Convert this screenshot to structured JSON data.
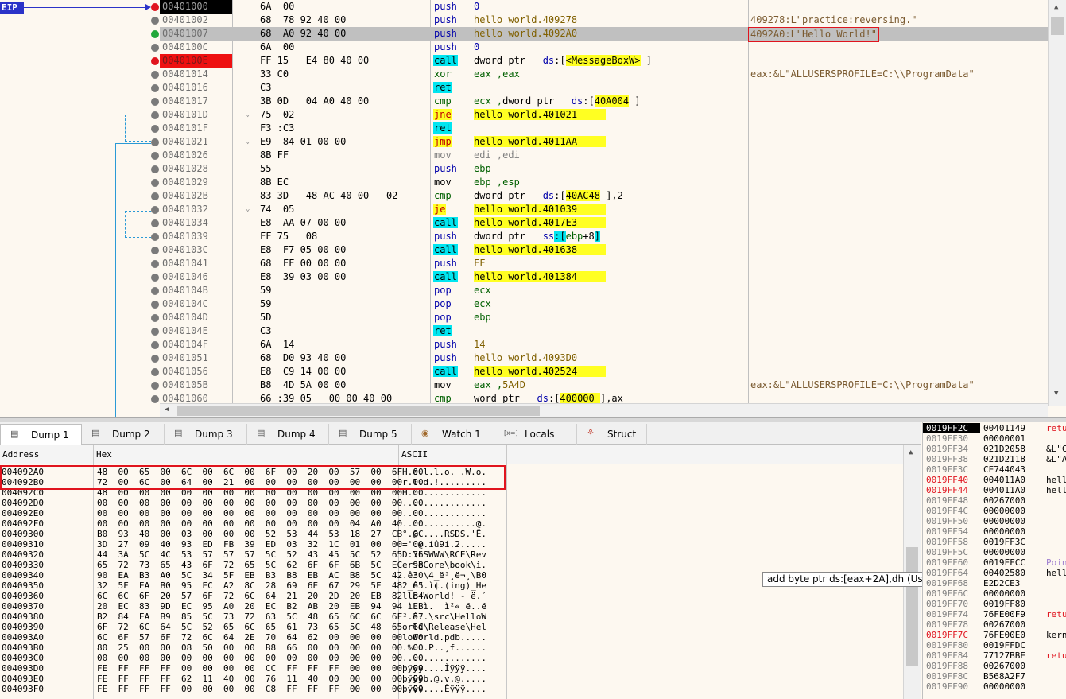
{
  "eip_label": "EIP",
  "disasm": [
    {
      "addr": "00401000",
      "addr_style": "hl-black",
      "bp": "red",
      "bytes": "6A  00",
      "mn": "push",
      "mnc": "mn-push",
      "ops": [
        {
          "t": "0",
          "c": "op-blue"
        }
      ],
      "cm": ""
    },
    {
      "addr": "00401002",
      "bp": "gray",
      "bytes": "68  78 92 40 00",
      "mn": "push",
      "mnc": "mn-push",
      "ops": [
        {
          "t": "hello world.409278",
          "c": ""
        }
      ],
      "cm": "409278:L\"practice:reversing.\""
    },
    {
      "addr": "00401007",
      "bp": "green",
      "sel": true,
      "bytes": "68  A0 92 40 00",
      "mn": "push",
      "mnc": "mn-push",
      "ops": [
        {
          "t": "hello world.4092A0",
          "c": ""
        }
      ],
      "cm": "4092A0:L\"Hello World!\"",
      "cmbox": true
    },
    {
      "addr": "0040100C",
      "bp": "gray",
      "bytes": "6A  00",
      "mn": "push",
      "mnc": "mn-push",
      "ops": [
        {
          "t": "0",
          "c": "op-blue"
        }
      ],
      "cm": ""
    },
    {
      "addr": "0040100E",
      "addr_style": "hl-red",
      "bp": "red",
      "bytes": "FF 15   E4 80 40 00",
      "mn": "call",
      "mnc": "mn-call",
      "ops": [
        {
          "t": "dword ptr   ",
          "c": "op-dark"
        },
        {
          "t": "ds",
          "c": "op-blue"
        },
        {
          "t": ":[",
          "c": "op-dark"
        },
        {
          "t": "<MessageBoxW>",
          "c": "op-y"
        },
        {
          "t": " ]",
          "c": "op-dark"
        }
      ],
      "cm": ""
    },
    {
      "addr": "00401014",
      "bp": "gray",
      "bytes": "33 C0",
      "mn": "xor",
      "mnc": "mn-xor",
      "ops": [
        {
          "t": "eax ,eax",
          "c": "op-green"
        }
      ],
      "cm": "eax:&L\"ALLUSERSPROFILE=C:\\\\ProgramData\""
    },
    {
      "addr": "00401016",
      "bp": "gray",
      "bytes": "C3",
      "mn": "ret",
      "mnc": "mn-ret",
      "ops": [],
      "cm": ""
    },
    {
      "addr": "00401017",
      "bp": "gray",
      "bytes": "3B 0D   04 A0 40 00",
      "mn": "cmp",
      "mnc": "mn-cmp",
      "ops": [
        {
          "t": "ecx ,",
          "c": "op-green"
        },
        {
          "t": "dword ptr   ",
          "c": "op-dark"
        },
        {
          "t": "ds",
          "c": "op-blue"
        },
        {
          "t": ":[",
          "c": "op-dark"
        },
        {
          "t": "40A004",
          "c": "op-y"
        },
        {
          "t": " ]",
          "c": "op-dark"
        }
      ],
      "cm": ""
    },
    {
      "addr": "0040101D",
      "bp": "gray",
      "arrow": true,
      "bytes": "75  02",
      "mn": "jne",
      "mnc": "mn-jmp",
      "ops": [
        {
          "t": "hello world.401021     ",
          "c": "op-y"
        }
      ],
      "cm": ""
    },
    {
      "addr": "0040101F",
      "bp": "gray",
      "bytes": "F3 :C3",
      "mn": "ret",
      "mnc": "mn-ret",
      "ops": [],
      "cm": ""
    },
    {
      "addr": "00401021",
      "bp": "gray",
      "arrow": true,
      "bytes": "E9  84 01 00 00",
      "mn": "jmp",
      "mnc": "mn-jmp",
      "ops": [
        {
          "t": "hello world.4011AA     ",
          "c": "op-y"
        }
      ],
      "cm": ""
    },
    {
      "addr": "00401026",
      "bp": "gray",
      "bytes": "8B FF",
      "mn": "mov",
      "mnc": "mn-movedi",
      "ops": [
        {
          "t": "edi ,edi",
          "c": "op-gray"
        }
      ],
      "cm": ""
    },
    {
      "addr": "00401028",
      "bp": "gray",
      "bytes": "55",
      "mn": "push",
      "mnc": "mn-push",
      "ops": [
        {
          "t": "ebp",
          "c": "op-green"
        }
      ],
      "cm": ""
    },
    {
      "addr": "00401029",
      "bp": "gray",
      "bytes": "8B EC",
      "mn": "mov",
      "mnc": "mn-mov",
      "ops": [
        {
          "t": "ebp ,esp",
          "c": "op-green"
        }
      ],
      "cm": ""
    },
    {
      "addr": "0040102B",
      "bp": "gray",
      "bytes": "83 3D   48 AC 40 00   02",
      "mn": "cmp",
      "mnc": "mn-cmp",
      "ops": [
        {
          "t": "dword ptr   ",
          "c": "op-dark"
        },
        {
          "t": "ds",
          "c": "op-blue"
        },
        {
          "t": ":[",
          "c": "op-dark"
        },
        {
          "t": "40AC48",
          "c": "op-y"
        },
        {
          "t": " ],2",
          "c": "op-dark"
        }
      ],
      "cm": ""
    },
    {
      "addr": "00401032",
      "bp": "gray",
      "arrow": true,
      "bytes": "74  05",
      "mn": "je",
      "mnc": "mn-jmp",
      "ops": [
        {
          "t": "hello world.401039     ",
          "c": "op-y"
        }
      ],
      "cm": ""
    },
    {
      "addr": "00401034",
      "bp": "gray",
      "bytes": "E8  AA 07 00 00",
      "mn": "call",
      "mnc": "mn-call",
      "ops": [
        {
          "t": "hello world.4017E3     ",
          "c": "op-y"
        }
      ],
      "cm": ""
    },
    {
      "addr": "00401039",
      "bp": "gray",
      "bytes": "FF 75   08",
      "mn": "push",
      "mnc": "mn-push",
      "ops": [
        {
          "t": "dword ptr   ",
          "c": "op-dark"
        },
        {
          "t": "ss",
          "c": "op-blue"
        },
        {
          "t": ":[",
          "c": "op-c"
        },
        {
          "t": "ebp",
          "c": "op-green"
        },
        {
          "t": "+8",
          "c": "op-dark"
        },
        {
          "t": "]",
          "c": "op-c"
        }
      ],
      "cm": ""
    },
    {
      "addr": "0040103C",
      "bp": "gray",
      "bytes": "E8  F7 05 00 00",
      "mn": "call",
      "mnc": "mn-call",
      "ops": [
        {
          "t": "hello world.401638     ",
          "c": "op-y"
        }
      ],
      "cm": ""
    },
    {
      "addr": "00401041",
      "bp": "gray",
      "bytes": "68  FF 00 00 00",
      "mn": "push",
      "mnc": "mn-push",
      "ops": [
        {
          "t": "FF",
          "c": ""
        }
      ],
      "cm": ""
    },
    {
      "addr": "00401046",
      "bp": "gray",
      "bytes": "E8  39 03 00 00",
      "mn": "call",
      "mnc": "mn-call",
      "ops": [
        {
          "t": "hello world.401384     ",
          "c": "op-y"
        }
      ],
      "cm": ""
    },
    {
      "addr": "0040104B",
      "bp": "gray",
      "bytes": "59",
      "mn": "pop",
      "mnc": "mn-pop",
      "ops": [
        {
          "t": "ecx",
          "c": "op-green"
        }
      ],
      "cm": ""
    },
    {
      "addr": "0040104C",
      "bp": "gray",
      "bytes": "59",
      "mn": "pop",
      "mnc": "mn-pop",
      "ops": [
        {
          "t": "ecx",
          "c": "op-green"
        }
      ],
      "cm": ""
    },
    {
      "addr": "0040104D",
      "bp": "gray",
      "bytes": "5D",
      "mn": "pop",
      "mnc": "mn-pop",
      "ops": [
        {
          "t": "ebp",
          "c": "op-green"
        }
      ],
      "cm": ""
    },
    {
      "addr": "0040104E",
      "bp": "gray",
      "bytes": "C3",
      "mn": "ret",
      "mnc": "mn-ret",
      "ops": [],
      "cm": ""
    },
    {
      "addr": "0040104F",
      "bp": "gray",
      "bytes": "6A  14",
      "mn": "push",
      "mnc": "mn-push",
      "ops": [
        {
          "t": "14",
          "c": ""
        }
      ],
      "cm": ""
    },
    {
      "addr": "00401051",
      "bp": "gray",
      "bytes": "68  D0 93 40 00",
      "mn": "push",
      "mnc": "mn-push",
      "ops": [
        {
          "t": "hello world.4093D0",
          "c": ""
        }
      ],
      "cm": ""
    },
    {
      "addr": "00401056",
      "bp": "gray",
      "bytes": "E8  C9 14 00 00",
      "mn": "call",
      "mnc": "mn-call",
      "ops": [
        {
          "t": "hello world.402524     ",
          "c": "op-y"
        }
      ],
      "cm": ""
    },
    {
      "addr": "0040105B",
      "bp": "gray",
      "bytes": "B8  4D 5A 00 00",
      "mn": "mov",
      "mnc": "mn-mov",
      "ops": [
        {
          "t": "eax ,",
          "c": "op-green"
        },
        {
          "t": "5A4D",
          "c": ""
        }
      ],
      "cm": "eax:&L\"ALLUSERSPROFILE=C:\\\\ProgramData\""
    },
    {
      "addr": "00401060",
      "bp": "gray",
      "bytes": "66 :39 05   00 00 40 00",
      "mn": "cmp",
      "mnc": "mn-cmp",
      "ops": [
        {
          "t": "word ptr   ",
          "c": "op-dark"
        },
        {
          "t": "ds",
          "c": "op-blue"
        },
        {
          "t": ":[",
          "c": "op-dark"
        },
        {
          "t": "400000 ",
          "c": "op-y"
        },
        {
          "t": "],ax",
          "c": "op-dark"
        }
      ],
      "cm": ""
    }
  ],
  "tabs": [
    {
      "label": "Dump 1",
      "icon": "dump-icon",
      "active": true
    },
    {
      "label": "Dump 2",
      "icon": "dump-icon"
    },
    {
      "label": "Dump 3",
      "icon": "dump-icon"
    },
    {
      "label": "Dump 4",
      "icon": "dump-icon"
    },
    {
      "label": "Dump 5",
      "icon": "dump-icon"
    },
    {
      "label": "Watch 1",
      "icon": "watch-icon"
    },
    {
      "label": "Locals",
      "icon": "locals-icon"
    },
    {
      "label": "Struct",
      "icon": "struct-icon"
    }
  ],
  "dump": {
    "headers": {
      "address": "Address",
      "hex": "Hex",
      "ascii": "ASCII"
    },
    "rows": [
      {
        "addr": "004092A0",
        "hex": "48  00  65  00  6C  00  6C  00  6F  00  20  00  57  00  6F  00",
        "ascii": "H.e.l.l.o. .W.o."
      },
      {
        "addr": "004092B0",
        "hex": "72  00  6C  00  64  00  21  00  00  00  00  00  00  00  00  00",
        "ascii": "r.l.d.!........."
      },
      {
        "addr": "004092C0",
        "hex": "48  00  00  00  00  00  00  00  00  00  00  00  00  00  00  00",
        "ascii": "H..............."
      },
      {
        "addr": "004092D0",
        "hex": "00  00  00  00  00  00  00  00  00  00  00  00  00  00  00  00",
        "ascii": "................"
      },
      {
        "addr": "004092E0",
        "hex": "00  00  00  00  00  00  00  00  00  00  00  00  00  00  00  00",
        "ascii": "................"
      },
      {
        "addr": "004092F0",
        "hex": "00  00  00  00  00  00  00  00  00  00  00  00  04  A0  40  00",
        "ascii": "..............@."
      },
      {
        "addr": "00409300",
        "hex": "B0  93  40  00  03  00  00  00  52  53  44  53  18  27  CB  0C",
        "ascii": "°.@.....RSDS.'Ë."
      },
      {
        "addr": "00409310",
        "hex": "3D  27  09  40  93  ED  FB  39  ED  03  32  1C  01  00  00  00",
        "ascii": "='.@.íû9í.2....."
      },
      {
        "addr": "00409320",
        "hex": "44  3A  5C  4C  53  57  57  57  5C  52  43  45  5C  52  65  76",
        "ascii": "D:\\LSWWW\\RCE\\Rev"
      },
      {
        "addr": "00409330",
        "hex": "65  72  73  65  43  6F  72  65  5C  62  6F  6F  6B  5C  EC  9B",
        "ascii": "erseCore\\book\\ì."
      },
      {
        "addr": "00409340",
        "hex": "90  EA  B3  A0  5C  34  5F  EB  B3  B8  EB  AC  B8  5C  42  30",
        "ascii": ".ê³ \\4_ë³¸ë¬¸\\B0"
      },
      {
        "addr": "00409350",
        "hex": "32  5F  EA  B0  95  EC  A2  8C  28  69  6E  67  29  5F  48  65",
        "ascii": "2_ê°.ì¢.(ing)_He"
      },
      {
        "addr": "00409360",
        "hex": "6C  6C  6F  20  57  6F  72  6C  64  21  20  2D  20  EB  82  B4",
        "ascii": "llo World! - ë.´"
      },
      {
        "addr": "00409370",
        "hex": "20  EC  83  9D  EC  95  A0  20  EC  B2  AB  20  EB  94  94  EB",
        "ascii": " ì..ì.  ì²« ë..ë"
      },
      {
        "addr": "00409380",
        "hex": "B2  84  EA  B9  85  5C  73  72  63  5C  48  65  6C  6C  6F  57",
        "ascii": "².ê¹.\\src\\HelloW"
      },
      {
        "addr": "00409390",
        "hex": "6F  72  6C  64  5C  52  65  6C  65  61  73  65  5C  48  65  6C",
        "ascii": "orld\\Release\\Hel"
      },
      {
        "addr": "004093A0",
        "hex": "6C  6F  57  6F  72  6C  64  2E  70  64  62  00  00  00  00  00",
        "ascii": "loWorld.pdb....."
      },
      {
        "addr": "004093B0",
        "hex": "80  25  00  00  08  50  00  00  B8  66  00  00  00  00  00  00",
        "ascii": ".%...P..¸f......"
      },
      {
        "addr": "004093C0",
        "hex": "00  00  00  00  00  00  00  00  00  00  00  00  00  00  00  00",
        "ascii": "................"
      },
      {
        "addr": "004093D0",
        "hex": "FE  FF  FF  FF  00  00  00  00  CC  FF  FF  FF  00  00  00  00",
        "ascii": "þÿÿÿ....Ìÿÿÿ...."
      },
      {
        "addr": "004093E0",
        "hex": "FE  FF  FF  FF  62  11  40  00  76  11  40  00  00  00  00  00",
        "ascii": "þÿÿÿb.@.v.@....."
      },
      {
        "addr": "004093F0",
        "hex": "FE  FF  FF  FF  00  00  00  00  C8  FF  FF  FF  00  00  00  00",
        "ascii": "þÿÿÿ....Èÿÿÿ...."
      }
    ]
  },
  "tooltip": "add byte ptr ds:[eax+2A],dh (User Code)",
  "stack": [
    {
      "addr": "0019FF2C",
      "val": "00401149",
      "cm": "retu",
      "top": true,
      "cmc": "red"
    },
    {
      "addr": "0019FF30",
      "val": "00000001",
      "cm": ""
    },
    {
      "addr": "0019FF34",
      "val": "021D2058",
      "cm": "&L\"C"
    },
    {
      "addr": "0019FF38",
      "val": "021D2118",
      "cm": "&L\"A"
    },
    {
      "addr": "0019FF3C",
      "val": "CE744043",
      "cm": ""
    },
    {
      "addr": "0019FF40",
      "val": "004011A0",
      "cm": "hell",
      "red": true
    },
    {
      "addr": "0019FF44",
      "val": "004011A0",
      "cm": "hell",
      "red": true
    },
    {
      "addr": "0019FF48",
      "val": "00267000",
      "cm": ""
    },
    {
      "addr": "0019FF4C",
      "val": "00000000",
      "cm": ""
    },
    {
      "addr": "0019FF50",
      "val": "00000000",
      "cm": ""
    },
    {
      "addr": "0019FF54",
      "val": "00000000",
      "cm": ""
    },
    {
      "addr": "0019FF58",
      "val": "0019FF3C",
      "cm": ""
    },
    {
      "addr": "0019FF5C",
      "val": "00000000",
      "cm": ""
    },
    {
      "addr": "0019FF60",
      "val": "0019FFCC",
      "cm": "Poin",
      "cmc": "vio"
    },
    {
      "addr": "0019FF64",
      "val": "00402580",
      "cm": "hell"
    },
    {
      "addr": "0019FF68",
      "val": "E2D2CE3",
      "cm": ""
    },
    {
      "addr": "0019FF6C",
      "val": "00000000",
      "cm": ""
    },
    {
      "addr": "0019FF70",
      "val": "0019FF80",
      "cm": ""
    },
    {
      "addr": "0019FF74",
      "val": "76FE00F9",
      "cm": "retu",
      "cmc": "red"
    },
    {
      "addr": "0019FF78",
      "val": "00267000",
      "cm": ""
    },
    {
      "addr": "0019FF7C",
      "val": "76FE00E0",
      "cm": "kern",
      "red": true
    },
    {
      "addr": "0019FF80",
      "val": "0019FFDC",
      "cm": ""
    },
    {
      "addr": "0019FF84",
      "val": "77127BBE",
      "cm": "retu",
      "cmc": "red"
    },
    {
      "addr": "0019FF88",
      "val": "00267000",
      "cm": ""
    },
    {
      "addr": "0019FF8C",
      "val": "B568A2F7",
      "cm": ""
    },
    {
      "addr": "0019FF90",
      "val": "00000000",
      "cm": ""
    }
  ]
}
